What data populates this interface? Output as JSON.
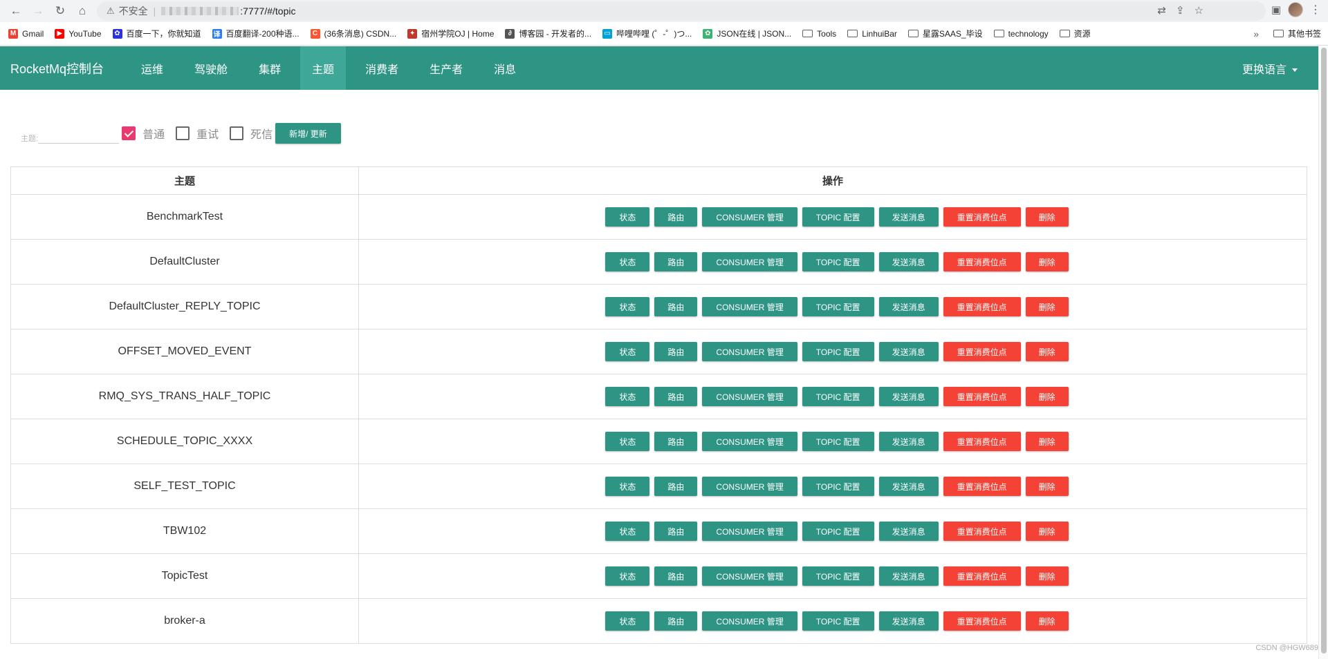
{
  "browser": {
    "nav": {
      "back": "←",
      "forward": "→",
      "reload": "↻",
      "home": "⌂"
    },
    "insecure_label": "不安全",
    "url_suffix": ":7777/#/topic",
    "bookmarks": [
      {
        "label": "Gmail",
        "icon": "gmail-icon",
        "color": "#ea4335",
        "glyph": "M"
      },
      {
        "label": "YouTube",
        "icon": "youtube-icon",
        "color": "#ff0000",
        "glyph": "▶"
      },
      {
        "label": "百度一下，你就知道",
        "icon": "baidu-icon",
        "color": "#2932e1",
        "glyph": "✿"
      },
      {
        "label": "百度翻译-200种语...",
        "icon": "translate-icon",
        "color": "#2b7cf6",
        "glyph": "译"
      },
      {
        "label": "(36条消息) CSDN...",
        "icon": "csdn-icon",
        "color": "#fc5531",
        "glyph": "C"
      },
      {
        "label": "宿州学院OJ | Home",
        "icon": "oj-icon",
        "color": "#c0392b",
        "glyph": "✦"
      },
      {
        "label": "博客园 - 开发者的...",
        "icon": "cnblogs-icon",
        "color": "#555555",
        "glyph": "∂"
      },
      {
        "label": "哔哩哔哩 (゜-゜)つ...",
        "icon": "bilibili-icon",
        "color": "#00a1d6",
        "glyph": "▭"
      },
      {
        "label": "JSON在线 | JSON...",
        "icon": "json-icon",
        "color": "#3cb371",
        "glyph": "✿"
      }
    ],
    "bookmark_folders": [
      "Tools",
      "LinhuiBar",
      "星露SAAS_毕设",
      "technology",
      "资源"
    ],
    "more_label": "»",
    "other_bookmarks": "其他书签"
  },
  "navbar": {
    "brand": "RocketMq控制台",
    "items": [
      "运维",
      "驾驶舱",
      "集群",
      "主题",
      "消费者",
      "生产者",
      "消息"
    ],
    "active": "主题",
    "language": "更换语言"
  },
  "filter": {
    "topic_label": "主题:",
    "checkboxes": [
      {
        "label": "普通",
        "checked": true
      },
      {
        "label": "重试",
        "checked": false
      },
      {
        "label": "死信",
        "checked": false
      }
    ],
    "add_button": "新增/ 更新"
  },
  "table": {
    "headers": [
      "主题",
      "操作"
    ],
    "actions": [
      "状态",
      "路由",
      "CONSUMER 管理",
      "TOPIC 配置",
      "发送消息",
      "重置消费位点",
      "删除"
    ],
    "rows": [
      "BenchmarkTest",
      "DefaultCluster",
      "DefaultCluster_REPLY_TOPIC",
      "OFFSET_MOVED_EVENT",
      "RMQ_SYS_TRANS_HALF_TOPIC",
      "SCHEDULE_TOPIC_XXXX",
      "SELF_TEST_TOPIC",
      "TBW102",
      "TopicTest",
      "broker-a"
    ]
  },
  "colors": {
    "primary": "#2e9585",
    "danger": "#f44336",
    "checked": "#e9396f"
  },
  "watermark": "CSDN @HGW689"
}
